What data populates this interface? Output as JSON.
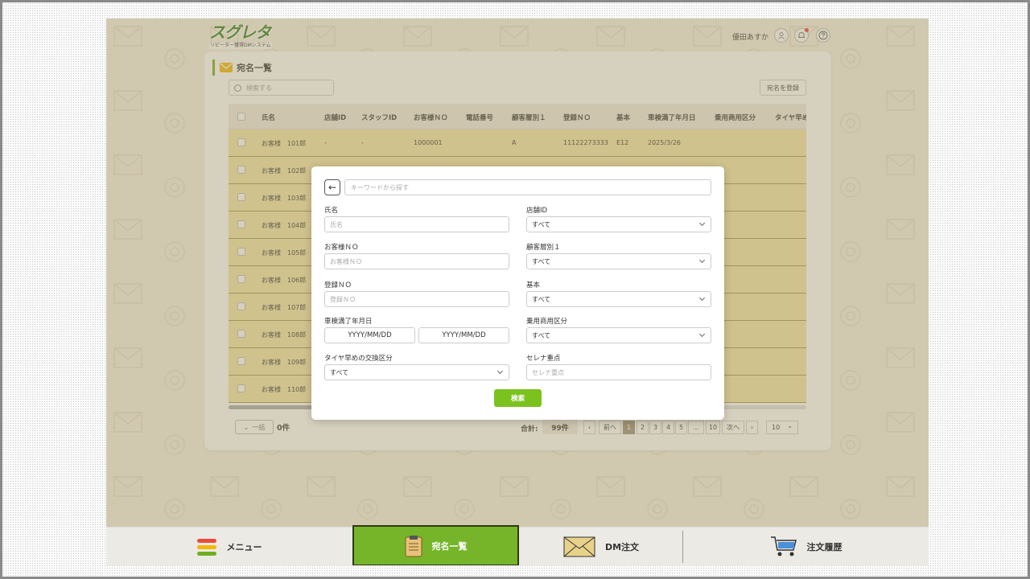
{
  "header": {
    "logo_main": "スグレタ",
    "logo_sub": "リピーター獲得DMシステム",
    "user_name": "優田あすか"
  },
  "panel": {
    "title": "宛名一覧",
    "search_placeholder": "検索する",
    "register_label": "宛名を登録"
  },
  "table": {
    "columns": [
      "氏名",
      "店舗ID",
      "スタッフID",
      "お客様ＮＯ",
      "電話番号",
      "顧客層別１",
      "登録ＮＯ",
      "基本",
      "車検満了年月日",
      "乗用商用区分",
      "タイヤ早め"
    ],
    "rows": [
      {
        "name": "お客様　101郎",
        "store": "-",
        "staff": "-",
        "customer_no": "1000001",
        "tier": "A",
        "reg_no": "11122273333",
        "basic": "E12",
        "date": "2025/3/26"
      },
      {
        "name": "お客様　102郎"
      },
      {
        "name": "お客様　103郎"
      },
      {
        "name": "お客様　104郎"
      },
      {
        "name": "お客様　105郎"
      },
      {
        "name": "お客様　106郎"
      },
      {
        "name": "お客様　107郎"
      },
      {
        "name": "お客様　108郎"
      },
      {
        "name": "お客様　109郎"
      },
      {
        "name": "お客様　110郎"
      }
    ]
  },
  "footer": {
    "batch_label": "一括",
    "selected_count": "0件",
    "total_label": "合計:",
    "total_count": "99件",
    "pages": [
      "前へ",
      "1",
      "2",
      "3",
      "4",
      "5",
      "...",
      "10",
      "次へ"
    ],
    "active_page": "1",
    "per_page": "10"
  },
  "modal": {
    "keyword_placeholder": "キーワードから探す",
    "fields": {
      "name_label": "氏名",
      "name_placeholder": "氏名",
      "store_label": "店舗ID",
      "store_value": "すべて",
      "customer_no_label": "お客様ＮＯ",
      "customer_no_placeholder": "お客様ＮＯ",
      "tier_label": "顧客層別１",
      "tier_value": "すべて",
      "reg_no_label": "登録ＮＯ",
      "reg_no_placeholder": "登録ＮＯ",
      "basic_label": "基本",
      "basic_value": "すべて",
      "inspection_label": "車検満了年月日",
      "date_from": "YYYY/MM/DD",
      "date_to": "YYYY/MM/DD",
      "vehicle_label": "乗用商用区分",
      "vehicle_value": "すべて",
      "tire_label": "タイヤ早めの交換区分",
      "tire_value": "すべて",
      "serena_label": "セレナ重点",
      "serena_placeholder": "セレナ重点"
    },
    "search_button": "検索"
  },
  "bottom_nav": [
    "メニュー",
    "宛名一覧",
    "DM注文",
    "注文履歴"
  ],
  "colors": {
    "accent": "#76b52a",
    "row_highlight": "#f3e5a6",
    "icon_yellow": "#f2b705"
  }
}
